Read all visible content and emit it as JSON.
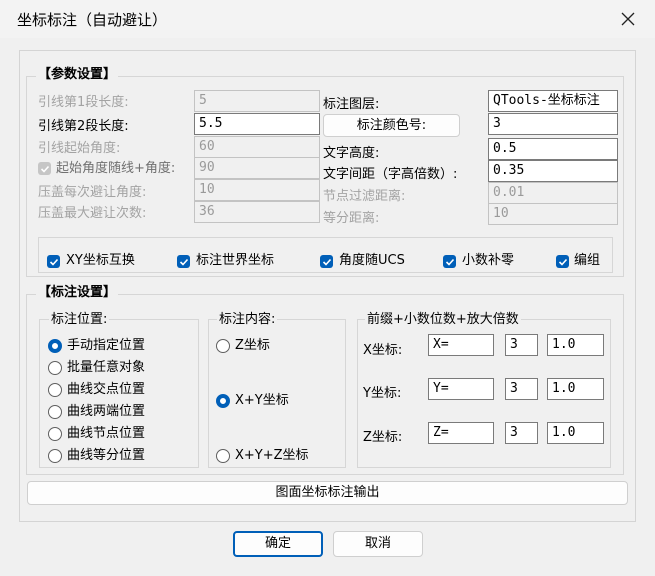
{
  "window": {
    "title": "坐标标注（自动避让）"
  },
  "params": {
    "title": "【参数设置】",
    "seg1_label": "引线第1段长度:",
    "seg1_value": "5",
    "seg2_label": "引线第2段长度:",
    "seg2_value": "5.5",
    "start_angle_label": "引线起始角度:",
    "start_angle_value": "60",
    "follow_angle_label": "起始角度随线+角度:",
    "follow_angle_value": "90",
    "avoid_angle_label": "压盖每次避让角度:",
    "avoid_angle_value": "10",
    "avoid_max_label": "压盖最大避让次数:",
    "avoid_max_value": "36",
    "layer_label": "标注图层:",
    "layer_value": "QTools-坐标标注",
    "color_button": "标注颜色号:",
    "color_value": "3",
    "text_height_label": "文字高度:",
    "text_height_value": "0.5",
    "text_spacing_label": "文字间距（字高倍数）:",
    "text_spacing_value": "0.35",
    "node_filter_label": "节点过滤距离:",
    "node_filter_value": "0.01",
    "equal_dist_label": "等分距离:",
    "equal_dist_value": "10"
  },
  "options": [
    "XY坐标互换",
    "标注世界坐标",
    "角度随UCS",
    "小数补零",
    "编组"
  ],
  "annot": {
    "title": "【标注设置】",
    "position_title": "标注位置:",
    "positions": [
      "手动指定位置",
      "批量任意对象",
      "曲线交点位置",
      "曲线两端位置",
      "曲线节点位置",
      "曲线等分位置"
    ],
    "selected_position": 0,
    "content_title": "标注内容:",
    "contents": [
      "Z坐标",
      "X+Y坐标",
      "X+Y+Z坐标"
    ],
    "selected_content": 1,
    "prefix_title": "前缀+小数位数+放大倍数",
    "x_label": "X坐标:",
    "x_prefix": "X=",
    "x_decimals": "3",
    "x_scale": "1.0",
    "y_label": "Y坐标:",
    "y_prefix": "Y=",
    "y_decimals": "3",
    "y_scale": "1.0",
    "z_label": "Z坐标:",
    "z_prefix": "Z=",
    "z_decimals": "3",
    "z_scale": "1.0"
  },
  "output_button": "图面坐标标注输出",
  "ok_button": "确定",
  "cancel_button": "取消",
  "colors": {
    "accent": "#005fb8",
    "disabled": "#a3a3a3"
  }
}
